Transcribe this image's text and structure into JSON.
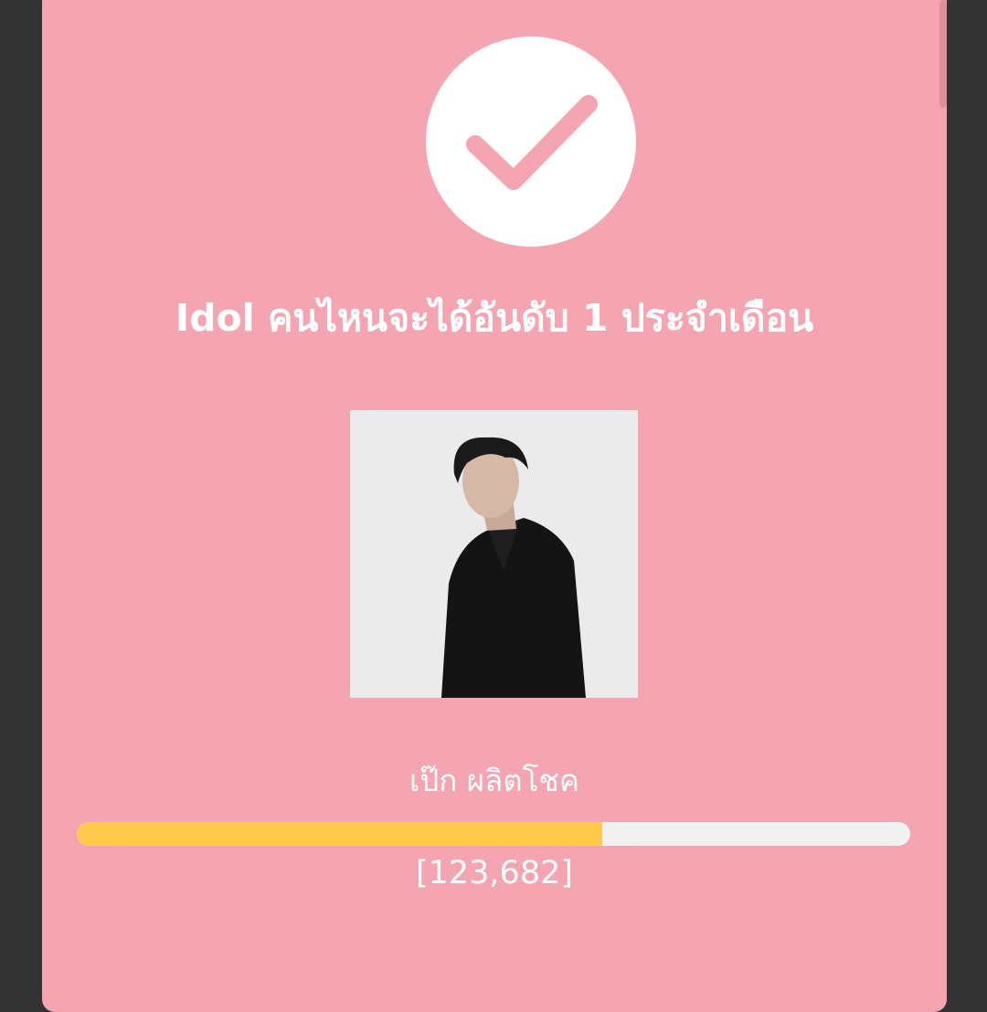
{
  "poll": {
    "title": "Idol คนไหนจะได้อันดับ 1 ประจำเดือน",
    "candidate": {
      "name": "เป๊ก ผลิตโชค",
      "votes_display": "[123,682]",
      "progress_fraction": 0.63
    },
    "status_icon": "check-icon"
  },
  "colors": {
    "background": "#f4a5b1",
    "progress_fill": "#ffc94d",
    "progress_track": "#f1f1f1",
    "check": "#f4a5b1"
  }
}
